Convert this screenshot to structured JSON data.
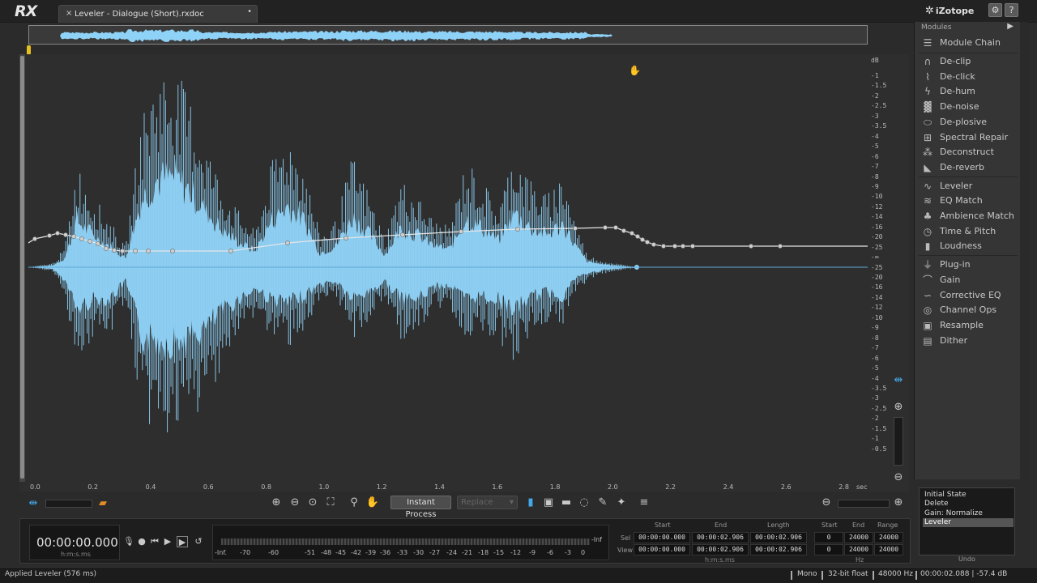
{
  "app": {
    "logo": "RX",
    "brand": "iZotope",
    "doc_tab": {
      "title": "Leveler - Dialogue (Short).rxdoc",
      "close": "×",
      "dot": "•"
    }
  },
  "colors": {
    "waveform": "#8fd2f7",
    "waveform_dark": "#5fa9d6",
    "gain_curve": "#e6e6e6",
    "playhead": "#e6c020",
    "accent_orange": "#e08a2a",
    "accent_blue": "#44a8e8"
  },
  "db_scale": {
    "unit_top": "dB",
    "labels_top": [
      "-1",
      "-1.5",
      "-2",
      "-2.5",
      "-3",
      "-3.5",
      "-4",
      "-5",
      "-6",
      "-7",
      "-8",
      "-9",
      "-10",
      "-12",
      "-14",
      "-16",
      "-20",
      "-25",
      "-∞",
      "-25",
      "-20",
      "-16",
      "-14",
      "-12",
      "-10",
      "-9",
      "-8",
      "-7",
      "-6",
      "-5",
      "-4",
      "-3.5",
      "-3",
      "-2.5",
      "-2",
      "-1.5",
      "-1",
      "-0.5"
    ]
  },
  "time_axis": {
    "labels": [
      "0.0",
      "0.2",
      "0.4",
      "0.6",
      "0.8",
      "1.0",
      "1.2",
      "1.4",
      "1.6",
      "1.8",
      "2.0",
      "2.2",
      "2.4",
      "2.6",
      "2.8"
    ],
    "unit": "sec"
  },
  "toolbar": {
    "instant_process": "Instant Process",
    "replace": "Replace"
  },
  "transport": {
    "timecode": "00:00:00.000",
    "timecode_format": "h:m:s.ms",
    "meter_ticks": [
      "-Inf.",
      "-70",
      "-60",
      "-51",
      "-48",
      "-45",
      "-42",
      "-39",
      "-36",
      "-33",
      "-30",
      "-27",
      "-24",
      "-21",
      "-18",
      "-15",
      "-12",
      "-9",
      "-6",
      "-3",
      "0"
    ],
    "meter_end": "-Inf"
  },
  "selection": {
    "headers": {
      "start": "Start",
      "end": "End",
      "length": "Length"
    },
    "sel_label": "Sel",
    "view_label": "View",
    "sel": {
      "start": "00:00:00.000",
      "end": "00:00:02.906",
      "length": "00:00:02.906"
    },
    "view": {
      "start": "00:00:00.000",
      "end": "00:00:02.906",
      "length": "00:00:02.906"
    },
    "time_unit": "h:m:s.ms",
    "freq_headers": {
      "start": "Start",
      "end": "End",
      "range": "Range"
    },
    "freq_sel": {
      "start": "0",
      "end": "24000",
      "range": "24000"
    },
    "freq_view": {
      "start": "0",
      "end": "24000",
      "range": "24000"
    },
    "freq_unit": "Hz"
  },
  "modules": {
    "header": "Modules",
    "arrow": "▶",
    "chain": {
      "label": "Module Chain",
      "icon": "list-icon"
    },
    "group1": [
      {
        "label": "De-clip",
        "icon": "declip-icon",
        "glyph": "∩"
      },
      {
        "label": "De-click",
        "icon": "declick-icon",
        "glyph": "⌇"
      },
      {
        "label": "De-hum",
        "icon": "dehum-icon",
        "glyph": "ϟ"
      },
      {
        "label": "De-noise",
        "icon": "denoise-icon",
        "glyph": "▓"
      },
      {
        "label": "De-plosive",
        "icon": "deplosive-icon",
        "glyph": "⬭"
      },
      {
        "label": "Spectral Repair",
        "icon": "spectral-repair-icon",
        "glyph": "⊞"
      },
      {
        "label": "Deconstruct",
        "icon": "deconstruct-icon",
        "glyph": "⁂"
      },
      {
        "label": "De-reverb",
        "icon": "dereverb-icon",
        "glyph": "◣"
      }
    ],
    "group2": [
      {
        "label": "Leveler",
        "icon": "leveler-icon",
        "glyph": "∿"
      },
      {
        "label": "EQ Match",
        "icon": "eq-match-icon",
        "glyph": "≋"
      },
      {
        "label": "Ambience Match",
        "icon": "ambience-match-icon",
        "glyph": "♣"
      },
      {
        "label": "Time & Pitch",
        "icon": "time-pitch-icon",
        "glyph": "◷"
      },
      {
        "label": "Loudness",
        "icon": "loudness-icon",
        "glyph": "▮"
      }
    ],
    "group3": [
      {
        "label": "Plug-in",
        "icon": "plugin-icon",
        "glyph": "⏚"
      },
      {
        "label": "Gain",
        "icon": "gain-icon",
        "glyph": "⌒"
      },
      {
        "label": "Corrective EQ",
        "icon": "corrective-eq-icon",
        "glyph": "∽"
      },
      {
        "label": "Channel Ops",
        "icon": "channel-ops-icon",
        "glyph": "◎"
      },
      {
        "label": "Resample",
        "icon": "resample-icon",
        "glyph": "▣"
      },
      {
        "label": "Dither",
        "icon": "dither-icon",
        "glyph": "▤"
      }
    ]
  },
  "undo": {
    "items": [
      "Initial State",
      "Delete",
      "Gain: Normalize",
      "Leveler"
    ],
    "active_index": 3,
    "label": "Undo"
  },
  "status": {
    "message": "Applied Leveler (576 ms)",
    "channels": "Mono",
    "bit_depth": "32-bit float",
    "sample_rate": "48000 Hz",
    "cursor": "00:00:02.088 | -57.4 dB"
  }
}
